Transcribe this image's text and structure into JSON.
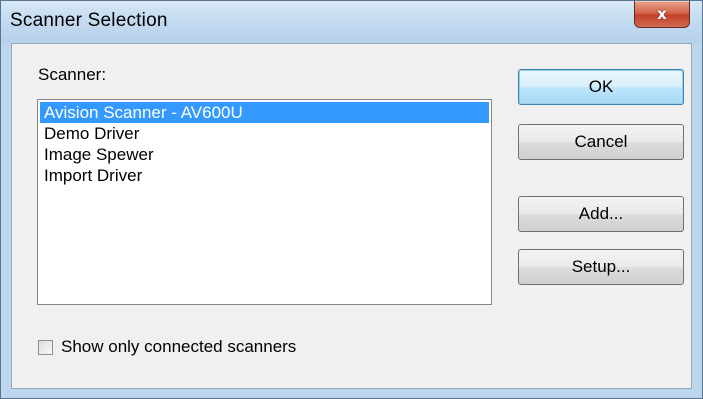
{
  "window": {
    "title": "Scanner Selection",
    "close_glyph": "x"
  },
  "scanner": {
    "label": "Scanner:",
    "items": [
      {
        "label": "Avision Scanner - AV600U",
        "selected": true
      },
      {
        "label": "Demo Driver",
        "selected": false
      },
      {
        "label": "Image Spewer",
        "selected": false
      },
      {
        "label": "Import Driver",
        "selected": false
      }
    ]
  },
  "buttons": {
    "ok": "OK",
    "cancel": "Cancel",
    "add": "Add...",
    "setup": "Setup..."
  },
  "options": {
    "show_connected_label": "Show only connected scanners",
    "show_connected_checked": false
  },
  "colors": {
    "selection": "#3399ff",
    "titlebar": "#bcd6ee",
    "close_button": "#c2412a"
  }
}
